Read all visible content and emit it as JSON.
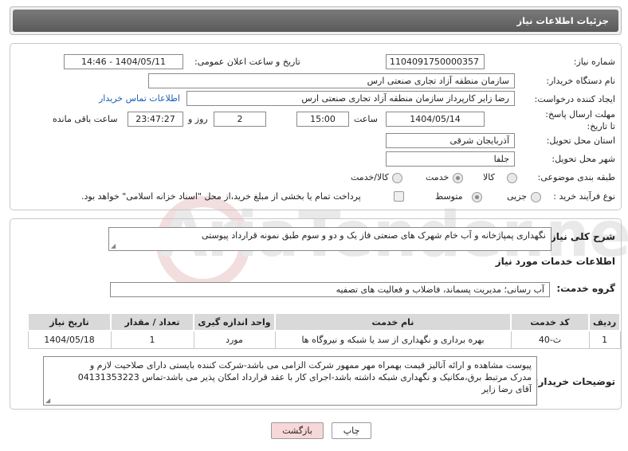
{
  "header": {
    "title": "جزئیات اطلاعات نیاز"
  },
  "form": {
    "need_number": {
      "label": "شماره نیاز:",
      "value": "1104091750000357"
    },
    "announce_datetime": {
      "label": "تاریخ و ساعت اعلان عمومی:",
      "value": "1404/05/11 - 14:46"
    },
    "buyer_org": {
      "label": "نام دستگاه خریدار:",
      "value": "سازمان منطقه آزاد تجاری صنعتی ارس"
    },
    "creator": {
      "label": "ایجاد کننده درخواست:",
      "value": "رضا زایر کارپرداز سازمان منطقه آزاد تجاری صنعتی ارس",
      "contact_link": "اطلاعات تماس خریدار"
    },
    "deadline": {
      "label": "مهلت ارسال پاسخ: تا تاریخ:",
      "date": "1404/05/14",
      "time_label": "ساعت",
      "time": "15:00",
      "days": "2",
      "days_label": "روز و",
      "remaining": "23:47:27",
      "remaining_label": "ساعت باقی مانده"
    },
    "province": {
      "label": "استان محل تحویل:",
      "value": "آذربایجان شرقی"
    },
    "city": {
      "label": "شهر محل تحویل:",
      "value": "جلفا"
    },
    "category": {
      "label": "طبقه بندی موضوعی:",
      "options": [
        "کالا",
        "خدمت",
        "کالا/خدمت"
      ],
      "selected": "خدمت"
    },
    "process": {
      "label": "نوع فرآیند خرید :",
      "options": [
        "جزیی",
        "متوسط"
      ],
      "selected": "متوسط",
      "payment_note": "پرداخت تمام یا بخشی از مبلغ خرید،از محل \"اسناد خزانه اسلامی\" خواهد بود."
    }
  },
  "summary": {
    "label": "شرح کلی نیاز:",
    "value": "نگهداری پمپاژخانه و آب خام شهرک های صنعتی فاز یک و دو و سوم طبق نمونه قرارداد پیوستی"
  },
  "services": {
    "section_title": "اطلاعات خدمات مورد نیاز",
    "group_label": "گروه خدمت:",
    "group_value": "آب رسانی؛ مدیریت پسماند، فاضلاب و فعالیت های تصفیه",
    "columns": [
      "ردیف",
      "کد خدمت",
      "نام خدمت",
      "واحد اندازه گیری",
      "تعداد / مقدار",
      "تاریخ نیاز"
    ],
    "rows": [
      {
        "row": "1",
        "code": "ث-40",
        "name": "بهره برداری و نگهداری از سد یا شبکه و نیروگاه ها",
        "unit": "مورد",
        "qty": "1",
        "date": "1404/05/18"
      }
    ]
  },
  "buyer_notes": {
    "label": "توضیحات خریدار:",
    "lines": [
      "پیوست مشاهده و ارائه آنالیز قیمت بهمراه مهر ممهور شرکت الزامی می باشد-شرکت کننده بایستی دارای صلاحیت لازم و",
      "مدرک مرتبط برق،مکانیک و نگهداری شبکه داشته باشد-اجرای کار با عقد قرارداد امکان پذیر می باشد-تماس 04131353223",
      "آقای رضا زایر"
    ]
  },
  "buttons": {
    "print": "چاپ",
    "back": "بازگشت"
  },
  "watermark": {
    "text": "AriaTender.net"
  },
  "colors": {
    "header_bg": "#666666",
    "link": "#1a5fb4",
    "back_button_bg": "#f7d7d7",
    "print_button_bg": "#ffffff"
  }
}
